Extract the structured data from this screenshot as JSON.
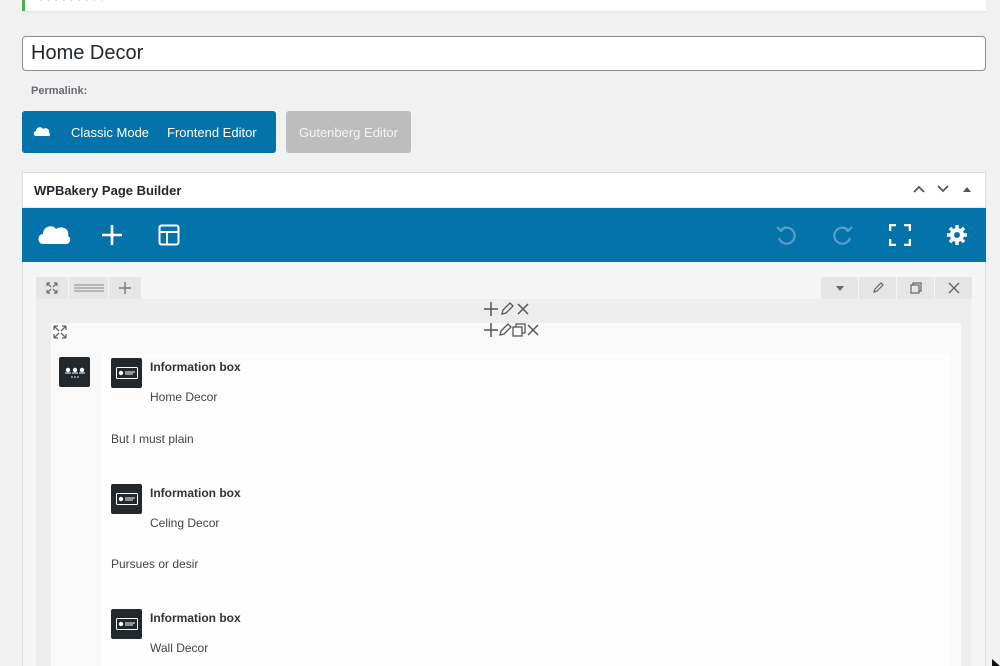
{
  "post": {
    "title": "Home Decor",
    "permalink_label": "Permalink:"
  },
  "modes": {
    "classic": "Classic Mode",
    "frontend": "Frontend Editor",
    "gutenberg": "Gutenberg Editor"
  },
  "builder": {
    "title": "WPBakery Page Builder",
    "accent": "#0473aa"
  },
  "elements": [
    {
      "title": "Information box",
      "subtitle": "Home Decor",
      "text": "But I must plain"
    },
    {
      "title": "Information box",
      "subtitle": "Celing Decor",
      "text": "Pursues or desir"
    },
    {
      "title": "Information box",
      "subtitle": "Wall Decor",
      "text": ""
    }
  ]
}
